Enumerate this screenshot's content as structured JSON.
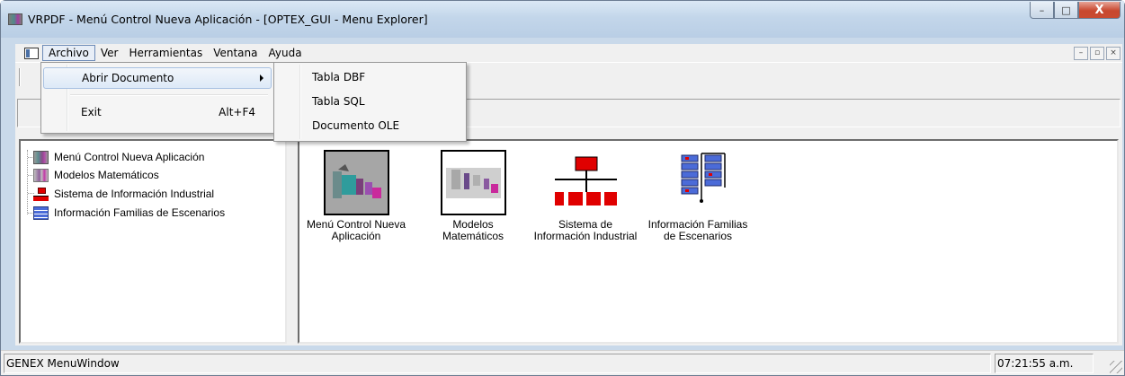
{
  "window": {
    "title": "VRPDF - Menú Control Nueva Aplicación - [OPTEX_GUI - Menu Explorer]",
    "min_glyph": "–",
    "max_glyph": "□",
    "close_glyph": "X"
  },
  "menubar": {
    "items": [
      "Archivo",
      "Ver",
      "Herramientas",
      "Ventana",
      "Ayuda"
    ],
    "active": "Archivo",
    "mdi_min": "–",
    "mdi_restore": "▫",
    "mdi_close": "×"
  },
  "archivo_menu": {
    "items": [
      {
        "label": "Abrir Documento",
        "has_submenu": true
      },
      {
        "label": "Exit",
        "shortcut": "Alt+F4"
      }
    ]
  },
  "abrir_submenu": {
    "items": [
      "Tabla DBF",
      "Tabla SQL",
      "Documento OLE"
    ]
  },
  "tree": {
    "items": [
      {
        "label": "Menú Control Nueva Aplicación",
        "icon": "menu-control-icon"
      },
      {
        "label": "Modelos Matemáticos",
        "icon": "math-models-icon"
      },
      {
        "label": "Sistema de Información Industrial",
        "icon": "org-chart-icon"
      },
      {
        "label": "Información Familias de Escenarios",
        "icon": "scenario-families-icon"
      }
    ]
  },
  "icons": {
    "items": [
      {
        "label": "Menú Control Nueva\nAplicación",
        "icon": "menu-control-icon",
        "selected": true
      },
      {
        "label": "Modelos\nMatemáticos",
        "icon": "math-models-icon"
      },
      {
        "label": "Sistema de\nInformación Industrial",
        "icon": "org-chart-icon"
      },
      {
        "label": "Información Familias\nde Escenarios",
        "icon": "scenario-families-icon"
      }
    ]
  },
  "statusbar": {
    "message": "GENEX MenuWindow",
    "time": "07:21:55 a.m."
  },
  "colors": {
    "accent_red": "#e00000",
    "accent_blue": "#4b6bd8",
    "selection_gray": "#a6a6a6"
  }
}
